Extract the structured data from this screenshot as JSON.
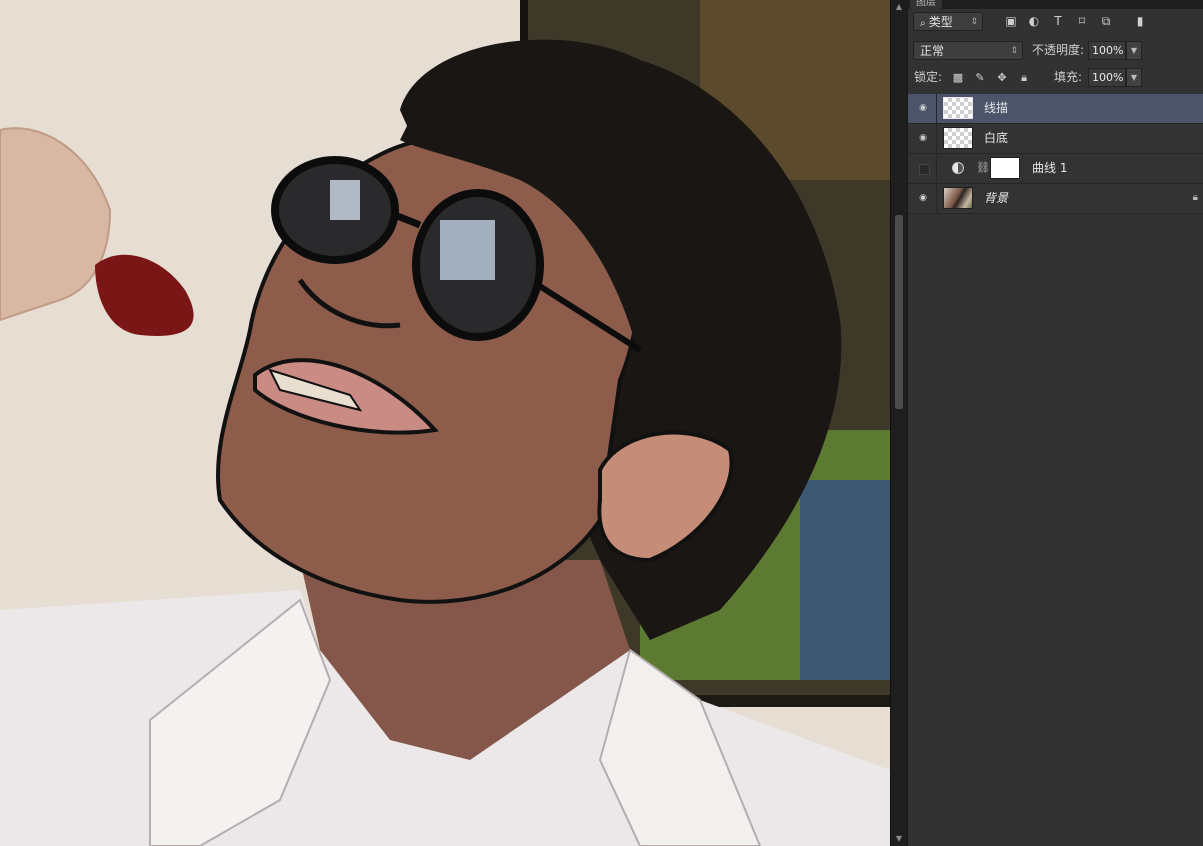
{
  "panel": {
    "tab_label": "图层",
    "filter": {
      "kind_label": "类型"
    },
    "blend_mode": "正常",
    "opacity_label": "不透明度:",
    "opacity_value": "100%",
    "lock_label": "锁定:",
    "fill_label": "填充:",
    "fill_value": "100%",
    "filter_icons": [
      "image-filter-icon",
      "adjustment-filter-icon",
      "type-filter-icon",
      "shape-filter-icon",
      "smart-object-filter-icon",
      "filter-toggle-icon"
    ],
    "lock_icons": [
      "lock-transparent-icon",
      "lock-paint-icon",
      "lock-position-icon",
      "lock-all-icon"
    ]
  },
  "layers": [
    {
      "name": "线描",
      "visible": true,
      "selected": true,
      "type": "transparent"
    },
    {
      "name": "白底",
      "visible": true,
      "selected": false,
      "type": "transparent"
    },
    {
      "name": "曲线 1",
      "visible": false,
      "selected": false,
      "type": "adjustment"
    },
    {
      "name": "背景",
      "visible": true,
      "selected": false,
      "type": "photo",
      "locked": true
    }
  ],
  "canvas": {
    "description_colors": {
      "background": "#e7ddd4",
      "hair": "#1a1614",
      "skin": "#8e5d4a",
      "shirt": "#ece8e8",
      "poster": "#3f3a2a"
    }
  }
}
